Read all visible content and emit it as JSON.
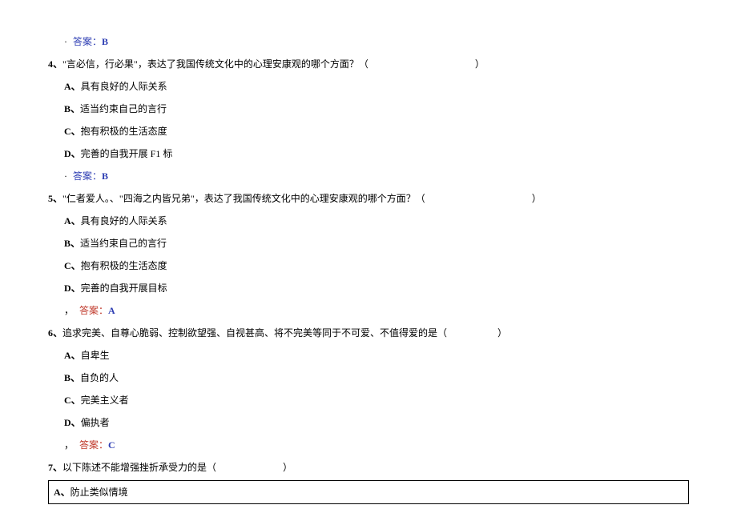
{
  "pre_answer": {
    "dot": "·",
    "label": "答案：",
    "value": "B"
  },
  "questions": [
    {
      "num": "4、",
      "text": "\"言必信，行必果\"，表达了我国传统文化中的心理安康观的哪个方面？（",
      "paren_close": "）",
      "options": [
        {
          "label": "A、",
          "text": "具有良好的人际关系"
        },
        {
          "label": "B、",
          "text": "适当约束自己的言行"
        },
        {
          "label": "C、",
          "text": "抱有积极的生活态度"
        },
        {
          "label": "D、",
          "text": "完善的自我开展 F1 标"
        }
      ],
      "answer": {
        "style": "blue",
        "dot": "·",
        "label": "答案：",
        "value": "B"
      }
    },
    {
      "num": "5、",
      "text": "\"仁者爱人。、\"四海之内皆兄弟\"，表达了我国传统文化中的心理安康观的哪个方面？（",
      "paren_close": "）",
      "options": [
        {
          "label": "A、",
          "text": "具有良好的人际关系"
        },
        {
          "label": "B、",
          "text": "适当约束自己的言行"
        },
        {
          "label": "C、",
          "text": "抱有积极的生活态度"
        },
        {
          "label": "D、",
          "text": "完善的自我开展目标"
        }
      ],
      "answer": {
        "style": "red",
        "dot": "，",
        "label": "答案：",
        "value": "A"
      }
    },
    {
      "num": "6、",
      "text": "追求完美、自尊心脆弱、控制欲望强、自视甚高、将不完美等同于不可爱、不值得爱的是（",
      "paren_close": "）",
      "options": [
        {
          "label": "A、",
          "text": "自卑生"
        },
        {
          "label": "B、",
          "text": "自负的人"
        },
        {
          "label": "C、",
          "text": "完美主义者"
        },
        {
          "label": "D、",
          "text": "偏执者"
        }
      ],
      "answer": {
        "style": "red",
        "dot": "，",
        "label": "答案：",
        "value": "C"
      }
    },
    {
      "num": "7、",
      "text": "以下陈述不能增强挫折承受力的是（",
      "paren_close": "）",
      "options": [
        {
          "label": "A、",
          "text": "防止类似情境",
          "boxed": true
        }
      ]
    }
  ]
}
